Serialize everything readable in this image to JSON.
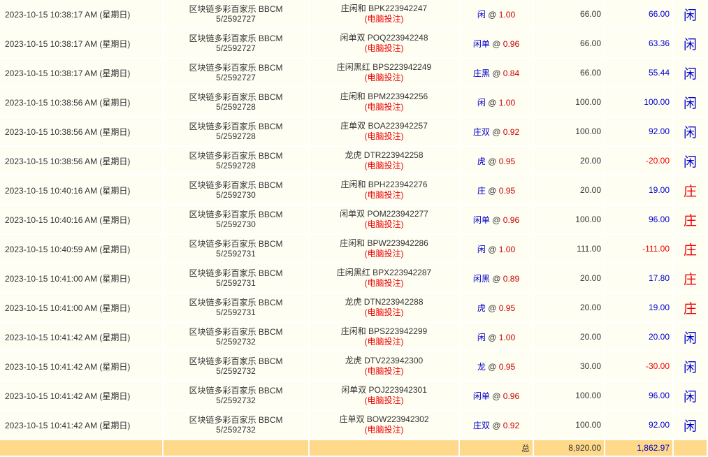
{
  "rows": [
    {
      "time": "2023-10-15 10:38:17 AM (星期日)",
      "game": "区块链多彩百家乐 BBCM",
      "round": "5/2592727",
      "bet_type": "庄闲和 BPK223942247",
      "source": "(电脑投注)",
      "pick": "闲",
      "odds": "1.00",
      "amount": "66.00",
      "win": "66.00",
      "win_sign": "pos",
      "result": "闲",
      "result_side": "p"
    },
    {
      "time": "2023-10-15 10:38:17 AM (星期日)",
      "game": "区块链多彩百家乐 BBCM",
      "round": "5/2592727",
      "bet_type": "闲单双 POQ223942248",
      "source": "(电脑投注)",
      "pick": "闲单",
      "odds": "0.96",
      "amount": "66.00",
      "win": "63.36",
      "win_sign": "pos",
      "result": "闲",
      "result_side": "p"
    },
    {
      "time": "2023-10-15 10:38:17 AM (星期日)",
      "game": "区块链多彩百家乐 BBCM",
      "round": "5/2592727",
      "bet_type": "庄闲黑红 BPS223942249",
      "source": "(电脑投注)",
      "pick": "庄黑",
      "odds": "0.84",
      "amount": "66.00",
      "win": "55.44",
      "win_sign": "pos",
      "result": "闲",
      "result_side": "p"
    },
    {
      "time": "2023-10-15 10:38:56 AM (星期日)",
      "game": "区块链多彩百家乐 BBCM",
      "round": "5/2592728",
      "bet_type": "庄闲和 BPM223942256",
      "source": "(电脑投注)",
      "pick": "闲",
      "odds": "1.00",
      "amount": "100.00",
      "win": "100.00",
      "win_sign": "pos",
      "result": "闲",
      "result_side": "p"
    },
    {
      "time": "2023-10-15 10:38:56 AM (星期日)",
      "game": "区块链多彩百家乐 BBCM",
      "round": "5/2592728",
      "bet_type": "庄单双 BOA223942257",
      "source": "(电脑投注)",
      "pick": "庄双",
      "odds": "0.92",
      "amount": "100.00",
      "win": "92.00",
      "win_sign": "pos",
      "result": "闲",
      "result_side": "p"
    },
    {
      "time": "2023-10-15 10:38:56 AM (星期日)",
      "game": "区块链多彩百家乐 BBCM",
      "round": "5/2592728",
      "bet_type": "龙虎 DTR223942258",
      "source": "(电脑投注)",
      "pick": "虎",
      "odds": "0.95",
      "amount": "20.00",
      "win": "-20.00",
      "win_sign": "neg",
      "result": "闲",
      "result_side": "p"
    },
    {
      "time": "2023-10-15 10:40:16 AM (星期日)",
      "game": "区块链多彩百家乐 BBCM",
      "round": "5/2592730",
      "bet_type": "庄闲和 BPH223942276",
      "source": "(电脑投注)",
      "pick": "庄",
      "odds": "0.95",
      "amount": "20.00",
      "win": "19.00",
      "win_sign": "pos",
      "result": "庄",
      "result_side": "b"
    },
    {
      "time": "2023-10-15 10:40:16 AM (星期日)",
      "game": "区块链多彩百家乐 BBCM",
      "round": "5/2592730",
      "bet_type": "闲单双 POM223942277",
      "source": "(电脑投注)",
      "pick": "闲单",
      "odds": "0.96",
      "amount": "100.00",
      "win": "96.00",
      "win_sign": "pos",
      "result": "庄",
      "result_side": "b"
    },
    {
      "time": "2023-10-15 10:40:59 AM (星期日)",
      "game": "区块链多彩百家乐 BBCM",
      "round": "5/2592731",
      "bet_type": "庄闲和 BPW223942286",
      "source": "(电脑投注)",
      "pick": "闲",
      "odds": "1.00",
      "amount": "111.00",
      "win": "-111.00",
      "win_sign": "neg",
      "result": "庄",
      "result_side": "b"
    },
    {
      "time": "2023-10-15 10:41:00 AM (星期日)",
      "game": "区块链多彩百家乐 BBCM",
      "round": "5/2592731",
      "bet_type": "庄闲黑红 BPX223942287",
      "source": "(电脑投注)",
      "pick": "闲黑",
      "odds": "0.89",
      "amount": "20.00",
      "win": "17.80",
      "win_sign": "pos",
      "result": "庄",
      "result_side": "b"
    },
    {
      "time": "2023-10-15 10:41:00 AM (星期日)",
      "game": "区块链多彩百家乐 BBCM",
      "round": "5/2592731",
      "bet_type": "龙虎 DTN223942288",
      "source": "(电脑投注)",
      "pick": "虎",
      "odds": "0.95",
      "amount": "20.00",
      "win": "19.00",
      "win_sign": "pos",
      "result": "庄",
      "result_side": "b"
    },
    {
      "time": "2023-10-15 10:41:42 AM (星期日)",
      "game": "区块链多彩百家乐 BBCM",
      "round": "5/2592732",
      "bet_type": "庄闲和 BPS223942299",
      "source": "(电脑投注)",
      "pick": "闲",
      "odds": "1.00",
      "amount": "20.00",
      "win": "20.00",
      "win_sign": "pos",
      "result": "闲",
      "result_side": "p"
    },
    {
      "time": "2023-10-15 10:41:42 AM (星期日)",
      "game": "区块链多彩百家乐 BBCM",
      "round": "5/2592732",
      "bet_type": "龙虎 DTV223942300",
      "source": "(电脑投注)",
      "pick": "龙",
      "odds": "0.95",
      "amount": "30.00",
      "win": "-30.00",
      "win_sign": "neg",
      "result": "闲",
      "result_side": "p"
    },
    {
      "time": "2023-10-15 10:41:42 AM (星期日)",
      "game": "区块链多彩百家乐 BBCM",
      "round": "5/2592732",
      "bet_type": "闲单双 POJ223942301",
      "source": "(电脑投注)",
      "pick": "闲单",
      "odds": "0.96",
      "amount": "100.00",
      "win": "96.00",
      "win_sign": "pos",
      "result": "闲",
      "result_side": "p"
    },
    {
      "time": "2023-10-15 10:41:42 AM (星期日)",
      "game": "区块链多彩百家乐 BBCM",
      "round": "5/2592732",
      "bet_type": "庄单双 BOW223942302",
      "source": "(电脑投注)",
      "pick": "庄双",
      "odds": "0.92",
      "amount": "100.00",
      "win": "92.00",
      "win_sign": "pos",
      "result": "闲",
      "result_side": "p"
    }
  ],
  "odds_separator": "@",
  "total": {
    "label": "总",
    "amount": "8,920.00",
    "win": "1,862.97"
  },
  "colors": {
    "row_bg": "#fffef3",
    "total_bg": "#ffd98a",
    "player_blue": "#0000cc",
    "banker_red": "#ee0000"
  }
}
